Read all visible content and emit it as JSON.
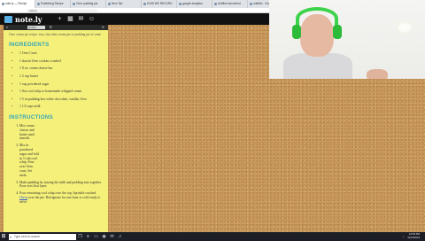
{
  "browser": {
    "tabs": [
      {
        "label": "note.ly — Recipe",
        "active": true
      },
      {
        "label": "Publishing Recipe",
        "active": false
      },
      {
        "label": "Oreo pudding pie",
        "active": false
      },
      {
        "label": "New Tab",
        "active": false
      },
      {
        "label": "HOW WE RECORD",
        "active": false
      },
      {
        "label": "google analytics",
        "active": false
      },
      {
        "label": "Untitled document",
        "active": false
      },
      {
        "label": "untitled - Google",
        "active": false
      }
    ],
    "url": "note.ly"
  },
  "app": {
    "logo": "note.ly",
    "toolbar_icons": [
      {
        "name": "add-icon",
        "glyph": "+"
      },
      {
        "name": "grid-icon",
        "glyph": "▦"
      },
      {
        "name": "share-icon",
        "glyph": "✉"
      },
      {
        "name": "user-icon",
        "glyph": "☺"
      }
    ]
  },
  "note": {
    "format": "normal",
    "intro": "Oreo cream pie recipe: easy chocolate cream pie or pudding pie of some",
    "ingredients_title": "INGREDIENTS",
    "ingredients": [
      "1 Oreo Crust",
      "1 shavin Oreo cookies crushed",
      "1 8 oz. cream cheese bar",
      "1 2 cup butter",
      "1 cup powdered sugar",
      "1 8oz cool whip or homemade whipped cream",
      "1 5 oz pudding box white chocolate, vanilla, Oreo",
      "1 1/2 cups milk"
    ],
    "instructions_title": "INSTRUCTIONS",
    "instructions": [
      {
        "text": "Mix cream cheese and butter until smooth.",
        "narrow": true
      },
      {
        "text": "Mix in powdered sugar and fold in ½ tub cool whip. Pour over Oreo crust. Set aside.",
        "narrow": true
      },
      {
        "text": "Make pudding by mixing the milk and pudding mix together. Pour over first layer.",
        "narrow": false
      },
      {
        "text_pre": "Pour remaining cool whip over the top. Sprinkle crushed ",
        "link": "Oreos",
        "text_post": " over the pie. Refrigerate for one hour to cold ready to serve.",
        "narrow": false
      }
    ]
  },
  "taskbar": {
    "search_placeholder": "Type here to search",
    "time": "10:53 PM",
    "date": "11/13/2019"
  },
  "colors": {
    "note_bg": "#f4f07a",
    "heading": "#36a6b5",
    "cork": "#c99a5c",
    "headphones": "#3cd34a"
  }
}
